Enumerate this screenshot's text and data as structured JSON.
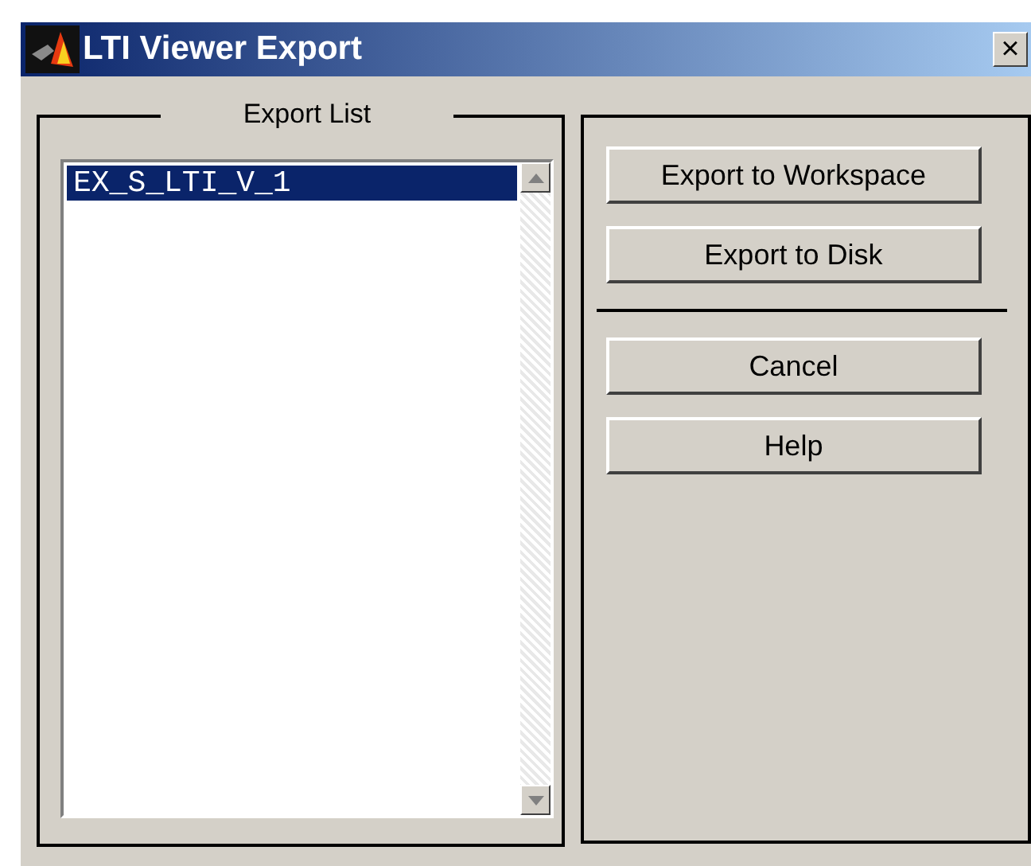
{
  "window": {
    "title": "LTI Viewer Export",
    "close": "×"
  },
  "export_list": {
    "title": "Export List",
    "items": [
      {
        "label": "EX_S_LTI_V_1",
        "selected": true
      }
    ]
  },
  "button_groups": [
    [
      "Export to Workspace",
      "Export to Disk"
    ],
    [
      "Cancel",
      "Help"
    ]
  ]
}
